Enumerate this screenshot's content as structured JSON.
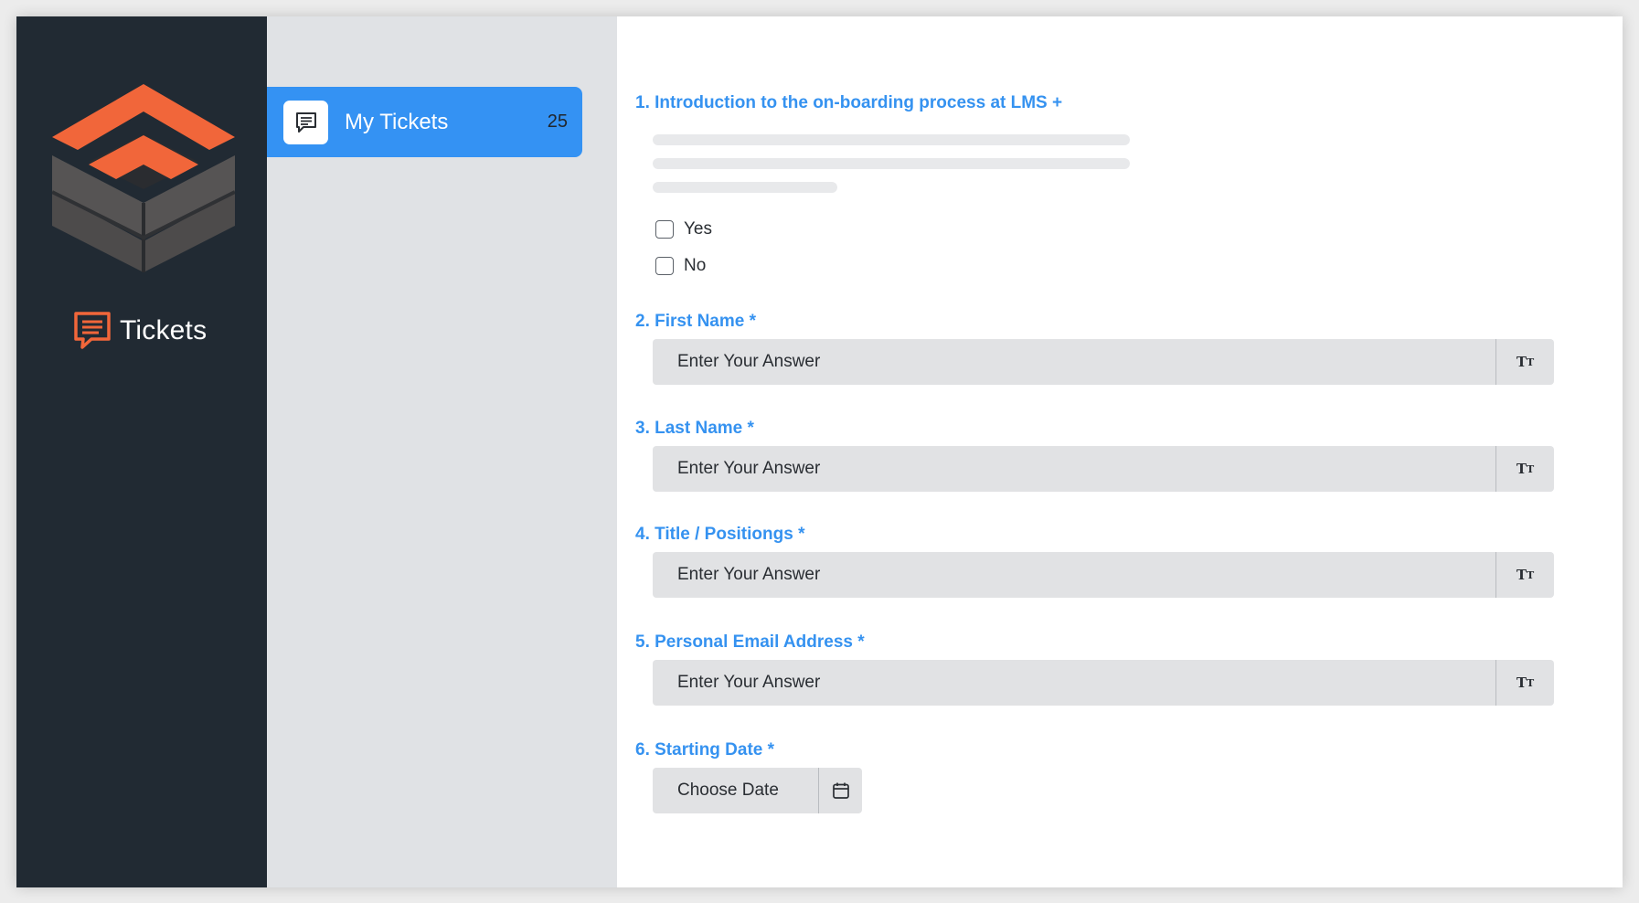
{
  "app": {
    "brand_label": "Tickets",
    "colors": {
      "rail_bg": "#212a33",
      "nav_bg": "#e0e2e5",
      "accent": "#3492f3",
      "brand_orange": "#f1663a",
      "label_blue": "#3592f0"
    }
  },
  "nav": {
    "items": [
      {
        "label": "My Tickets",
        "count": "25",
        "icon": "chat-icon"
      }
    ]
  },
  "form": {
    "questions": [
      {
        "label": "1. Introduction to the on-boarding process at LMS +",
        "options": [
          "Yes",
          "No"
        ]
      },
      {
        "label": "2. First Name *",
        "placeholder": "Enter Your Answer",
        "addon": "text-format-icon"
      },
      {
        "label": "3. Last Name *",
        "placeholder": "Enter Your Answer",
        "addon": "text-format-icon"
      },
      {
        "label": "4. Title / Positiongs *",
        "placeholder": "Enter Your Answer",
        "addon": "text-format-icon"
      },
      {
        "label": "5. Personal Email Address *",
        "placeholder": "Enter Your Answer",
        "addon": "text-format-icon"
      },
      {
        "label": "6. Starting Date *",
        "placeholder": "Choose Date",
        "addon": "calendar-icon"
      }
    ]
  }
}
